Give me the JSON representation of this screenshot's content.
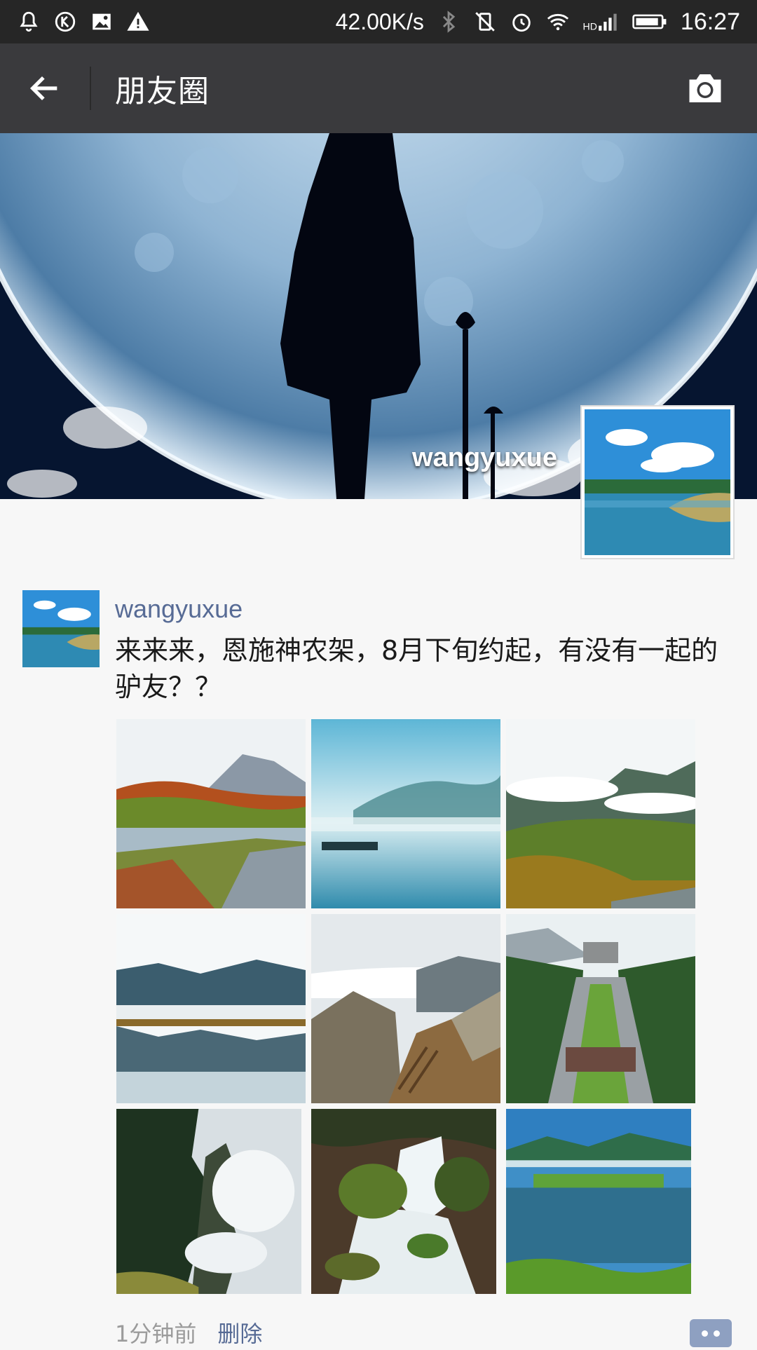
{
  "status_bar": {
    "left_icons": [
      "alarm-bell-icon",
      "k-app-icon",
      "gallery-icon",
      "warning-icon"
    ],
    "network_speed": "42.00K/s",
    "right_icons": [
      "bluetooth-icon",
      "vibrate-off-icon",
      "alarm-clock-icon",
      "wifi-icon",
      "hd-signal-icon",
      "battery-icon"
    ],
    "time": "16:27"
  },
  "header": {
    "title": "朋友圈",
    "back_icon": "back-arrow-icon",
    "camera_icon": "camera-icon"
  },
  "cover": {
    "username": "wangyuxue"
  },
  "post": {
    "username": "wangyuxue",
    "text": "来来来，恩施神农架，8月下旬约起，有没有一起的驴友？？",
    "photos": [
      "autumn-lake-walkway-photo",
      "misty-lake-photo",
      "mountain-clouds-forest-photo",
      "mountain-reflection-lake-photo",
      "cliff-stairs-photo",
      "monument-avenue-photo",
      "misty-peaks-photo",
      "waterfall-photo",
      "green-lake-photo"
    ],
    "time": "1分钟前",
    "delete_label": "删除"
  },
  "colors": {
    "status_bar_bg": "#262626",
    "header_bg": "#3a3a3d",
    "link_blue": "#576b95",
    "page_bg": "#f7f7f7"
  }
}
